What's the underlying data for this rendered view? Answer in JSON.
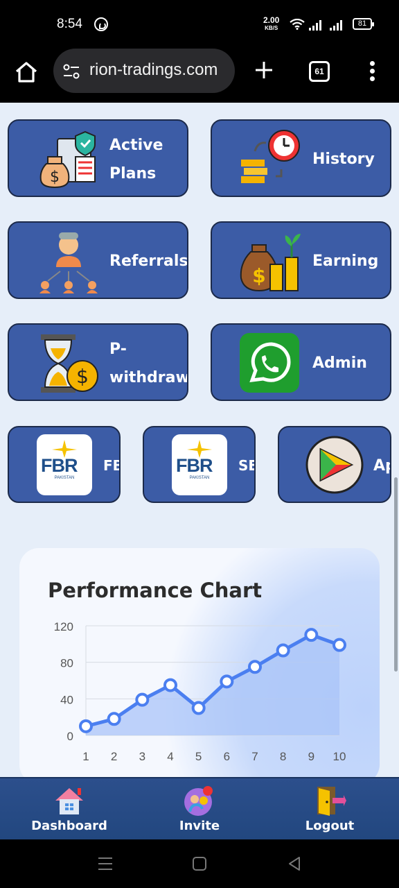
{
  "status_bar": {
    "time": "8:54",
    "net_speed_value": "2.00",
    "net_speed_unit": "KB/S",
    "battery": "81"
  },
  "browser": {
    "url": "rion-tradings.com",
    "tab_count": "61"
  },
  "tiles": [
    {
      "label": "Active Plans",
      "label_line1": "Active",
      "label_line2": "Plans",
      "icon": "active-plans-icon"
    },
    {
      "label": "History",
      "icon": "history-icon"
    },
    {
      "label": "Referrals",
      "icon": "referrals-icon"
    },
    {
      "label": "Earning",
      "icon": "earning-icon"
    },
    {
      "label": "P-withdraw",
      "label_line1": "P-",
      "label_line2": "withdraw",
      "icon": "withdraw-icon"
    },
    {
      "label": "Admin",
      "icon": "whatsapp-icon"
    }
  ],
  "small_tiles": [
    {
      "label": "FBR",
      "logo": "FBR",
      "logo_sub": "PAKISTAN"
    },
    {
      "label": "SECP",
      "logo": "FBR",
      "logo_sub": "PAKISTAN"
    },
    {
      "label": "App",
      "icon": "play-app-icon"
    }
  ],
  "chart_data": {
    "type": "area",
    "title": "Performance Chart",
    "x": [
      1,
      2,
      3,
      4,
      5,
      6,
      7,
      8,
      9,
      10
    ],
    "values": [
      10,
      18,
      39,
      55,
      30,
      59,
      75,
      93,
      110,
      99
    ],
    "ylim": [
      0,
      120
    ],
    "yticks": [
      0,
      40,
      80,
      120
    ],
    "grid": true,
    "line_color": "#4b7ff0",
    "fill_color": "#a9c4f8"
  },
  "bottom_nav": {
    "items": [
      {
        "label": "Dashboard",
        "icon": "house-icon"
      },
      {
        "label": "Invite",
        "icon": "invite-icon"
      },
      {
        "label": "Logout",
        "icon": "logout-door-icon"
      }
    ]
  },
  "colors": {
    "tile_bg": "#3c5ca6",
    "page_bg": "#e6eef9",
    "nav_bg": "#2c4f8c"
  }
}
